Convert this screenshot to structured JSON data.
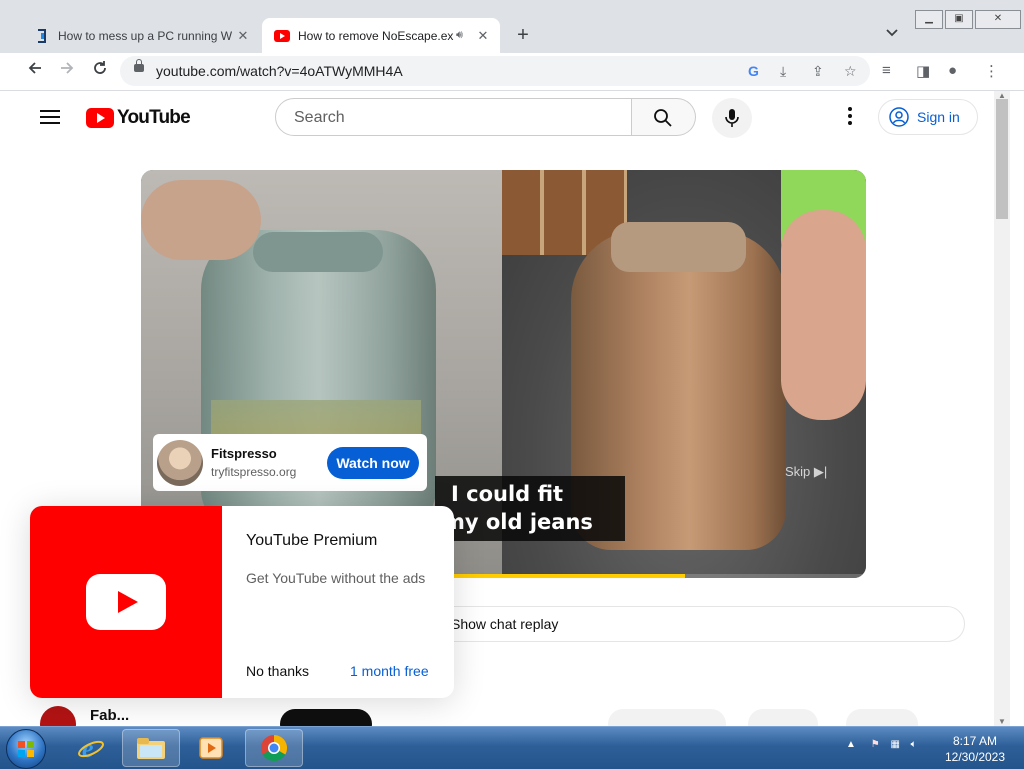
{
  "browser": {
    "tabs": [
      {
        "title": "How to mess up a PC running W",
        "active": false
      },
      {
        "title": "How to remove NoEscape.ex",
        "active": true,
        "audio": true
      }
    ],
    "url": "youtube.com/watch?v=4oATWyMMH4A"
  },
  "youtube": {
    "logo_text": "YouTube",
    "search_placeholder": "Search",
    "signin_label": "Sign in",
    "ad": {
      "name": "Fitspresso",
      "url": "tryfitspresso.org",
      "cta": "Watch now",
      "skip": "Skip ▶|"
    },
    "caption": {
      "line1": "I could fit",
      "line2": "my old jeans"
    },
    "progress": 0.75,
    "chat_replay": "Show chat replay",
    "channel_partial": "Fab..."
  },
  "premium_popup": {
    "title": "YouTube Premium",
    "subtitle": "Get YouTube without the ads",
    "dismiss": "No thanks",
    "offer": "1 month free"
  },
  "taskbar": {
    "time": "8:17 AM",
    "date": "12/30/2023"
  },
  "colors": {
    "youtube_red": "#ff0000",
    "link_blue": "#065fd4",
    "ad_blue": "#065fd4",
    "progress_yellow": "#ffcc00"
  }
}
